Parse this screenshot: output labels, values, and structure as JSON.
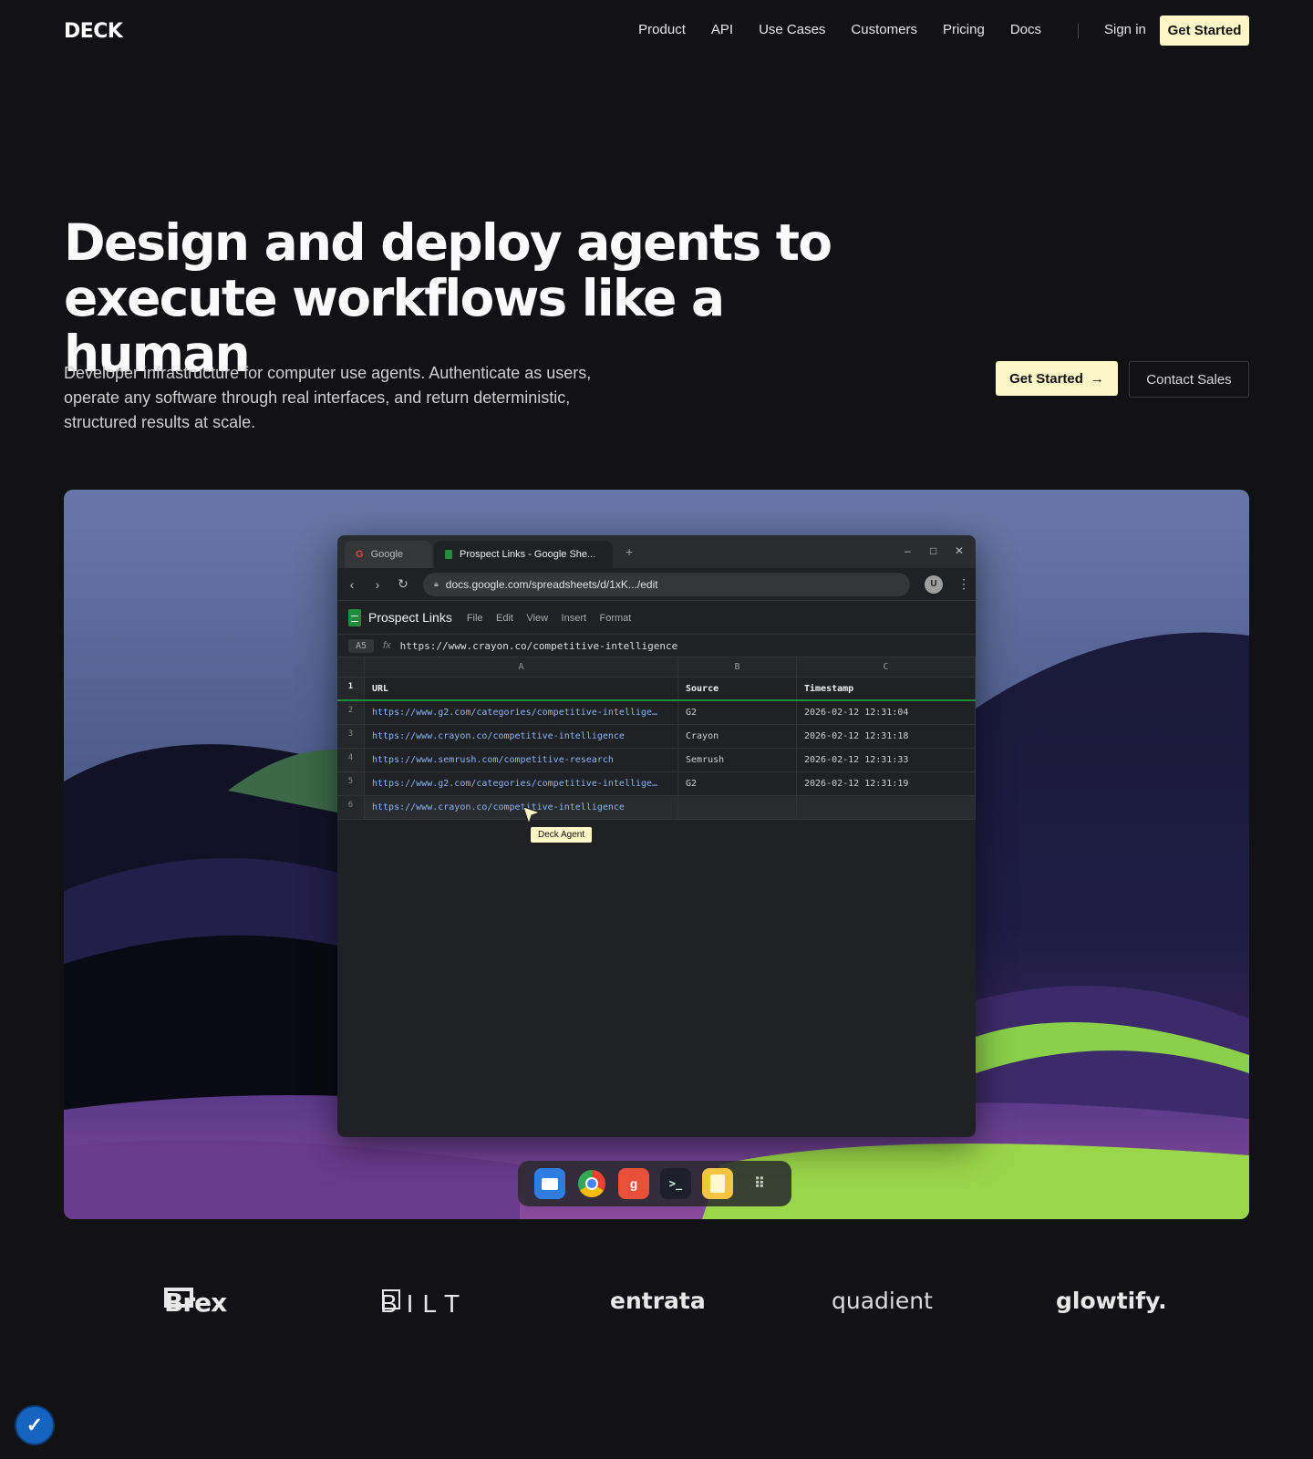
{
  "nav": {
    "logo": "DECK",
    "links": [
      "Product",
      "API",
      "Use Cases",
      "Customers",
      "Pricing",
      "Docs"
    ],
    "sign_in": "Sign in",
    "cta": "Get Started"
  },
  "hero": {
    "title_line1": "Design and deploy agents to",
    "title_line2": "execute workflows like a human",
    "subtitle": "Developer infrastructure for computer use agents. Authenticate as users, operate any software through real interfaces, and return deterministic, structured results at scale.",
    "cta_primary": "Get Started",
    "cta_secondary": "Contact Sales"
  },
  "browser": {
    "tab1": "Google",
    "tab2": "Prospect Links - Google She...",
    "url": "docs.google.com/spreadsheets/d/1xK.../edit",
    "avatar": "U",
    "sheet_title": "Prospect Links",
    "menu": [
      "File",
      "Edit",
      "View",
      "Insert",
      "Format"
    ],
    "cell_ref": "A5",
    "fx": "fx",
    "formula": "https://www.crayon.co/competitive-intelligence",
    "columns": [
      "A",
      "B",
      "C"
    ],
    "rows": [
      {
        "n": "1",
        "a": "URL",
        "b": "Source",
        "c": "Timestamp"
      },
      {
        "n": "2",
        "a": "https://www.g2.com/categories/competitive-intellige…",
        "b": "G2",
        "c": "2026-02-12 12:31:04"
      },
      {
        "n": "3",
        "a": "https://www.crayon.co/competitive-intelligence",
        "b": "Crayon",
        "c": "2026-02-12 12:31:18"
      },
      {
        "n": "4",
        "a": "https://www.semrush.com/competitive-research",
        "b": "Semrush",
        "c": "2026-02-12 12:31:33"
      },
      {
        "n": "5",
        "a": "https://www.g2.com/categories/competitive-intellige…",
        "b": "G2",
        "c": "2026-02-12 12:31:19"
      },
      {
        "n": "6",
        "a": "https://www.crayon.co/competitive-intelligence",
        "b": "",
        "c": ""
      }
    ],
    "agent_label": "Deck Agent"
  },
  "dock": {
    "apps": [
      "files-icon",
      "chrome-icon",
      "g-app-icon",
      "terminal-icon",
      "notes-icon",
      "app-grid-icon"
    ],
    "g_letter": "g",
    "terminal_glyph": ">_"
  },
  "customers": [
    "Brex",
    "BILT",
    "entrata",
    "quadient",
    "glowtify."
  ],
  "colors": {
    "accent": "#fdf7c7",
    "background": "#121214",
    "link": "#8ab4f8",
    "sheet_green": "#1e8e3e"
  }
}
